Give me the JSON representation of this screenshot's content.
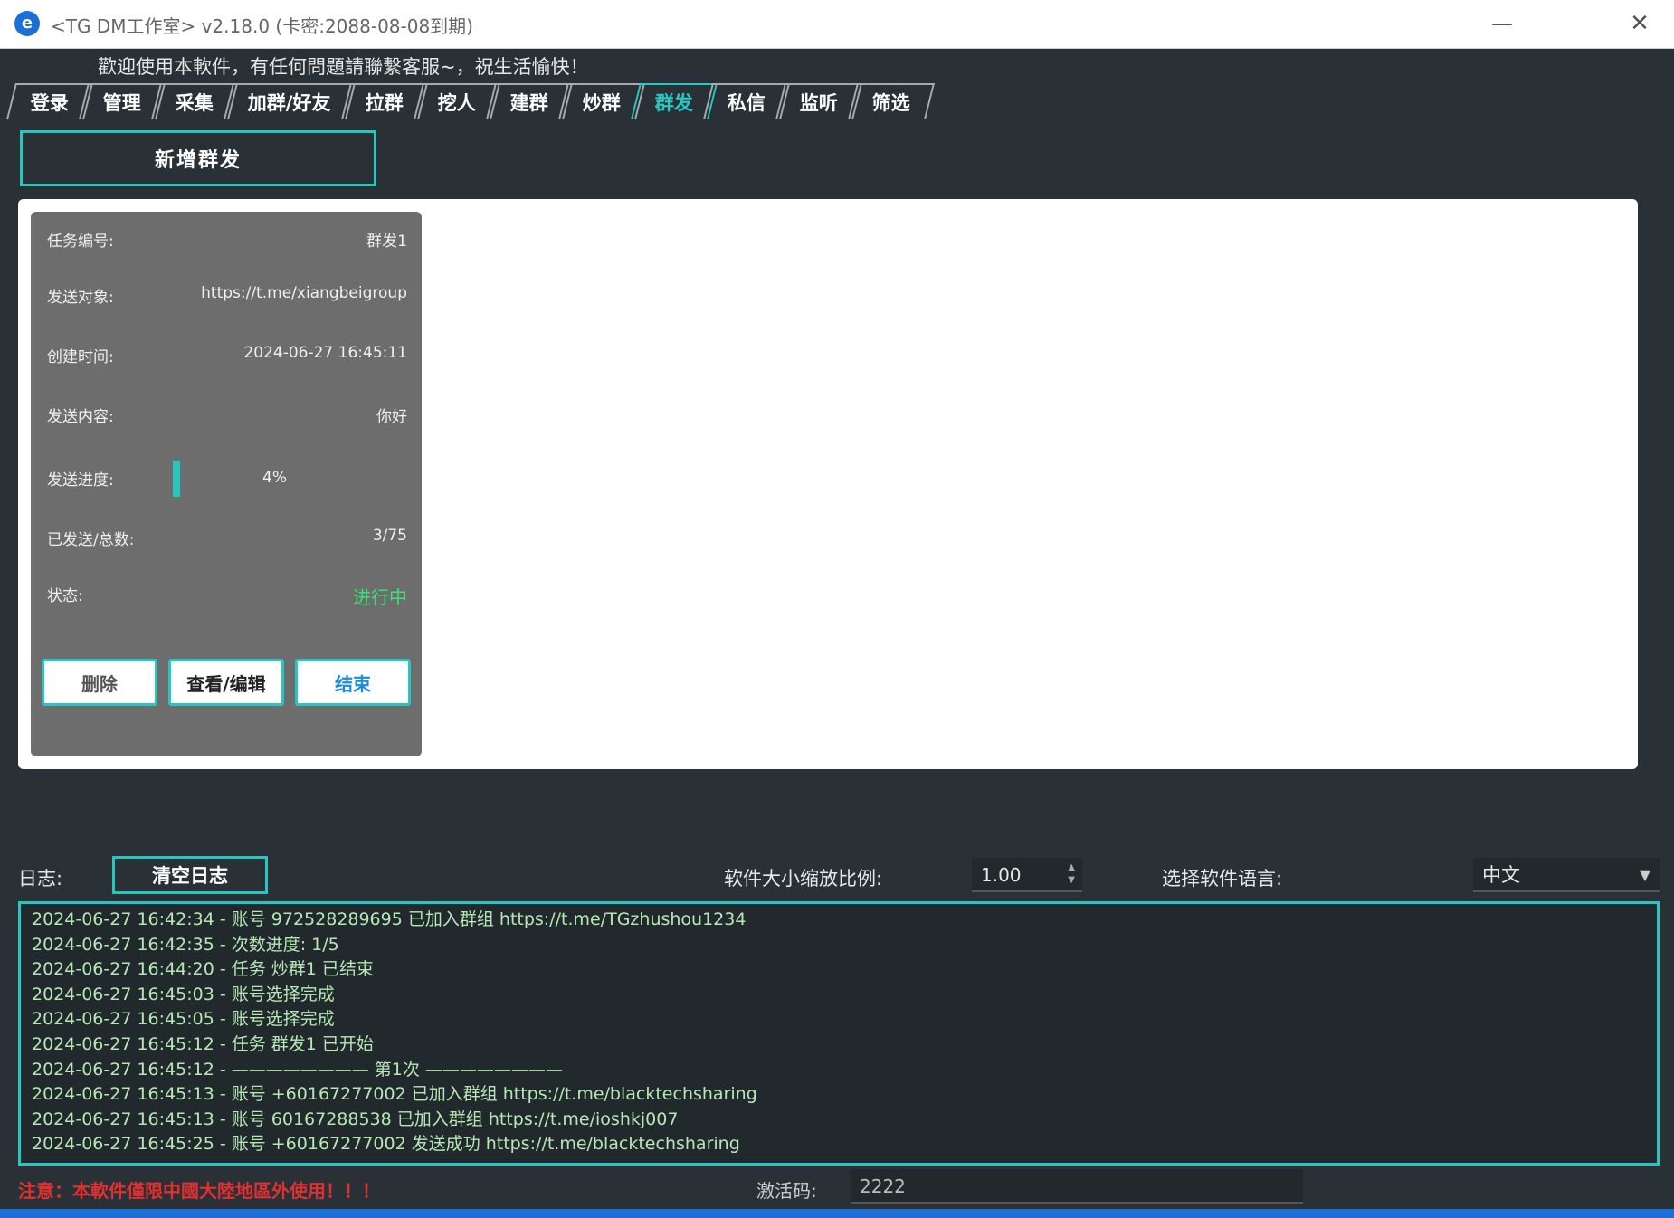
{
  "window": {
    "title": "<TG DM工作室> v2.18.0 (卡密:2088-08-08到期)",
    "minimize": "—",
    "close": "✕"
  },
  "welcome": "歡迎使用本軟件，有任何問題請聯繫客服~，祝生活愉快！",
  "tabs": [
    {
      "label": "登录",
      "active": false
    },
    {
      "label": "管理",
      "active": false
    },
    {
      "label": "采集",
      "active": false
    },
    {
      "label": "加群/好友",
      "active": false
    },
    {
      "label": "拉群",
      "active": false
    },
    {
      "label": "挖人",
      "active": false
    },
    {
      "label": "建群",
      "active": false
    },
    {
      "label": "炒群",
      "active": false
    },
    {
      "label": "群发",
      "active": true
    },
    {
      "label": "私信",
      "active": false
    },
    {
      "label": "监听",
      "active": false
    },
    {
      "label": "筛选",
      "active": false
    }
  ],
  "add_button": "新增群发",
  "task": {
    "id_label": "任务编号:",
    "id_value": "群发1",
    "target_label": "发送对象:",
    "target_value": "https://t.me/xiangbeigroup",
    "created_label": "创建时间:",
    "created_value": "2024-06-27 16:45:11",
    "content_label": "发送内容:",
    "content_value": "你好",
    "progress_label": "发送进度:",
    "progress_percent": 4,
    "progress_text": "4%",
    "sent_label": "已发送/总数:",
    "sent_value": "3/75",
    "status_label": "状态:",
    "status_value": "进行中",
    "delete_button": "删除",
    "view_button": "查看/编辑",
    "end_button": "结束"
  },
  "log": {
    "label": "日志:",
    "clear_button": "清空日志",
    "lines": [
      "2024-06-27 16:42:34 - 账号 972528289695 已加入群组 https://t.me/TGzhushou1234",
      "2024-06-27 16:42:35 - 次数进度: 1/5",
      "2024-06-27 16:44:20 - 任务 炒群1 已结束",
      "2024-06-27 16:45:03 - 账号选择完成",
      "2024-06-27 16:45:05 - 账号选择完成",
      "2024-06-27 16:45:12 - 任务 群发1 已开始",
      "2024-06-27 16:45:12 - ———————— 第1次 ————————",
      "2024-06-27 16:45:13 - 账号 +60167277002 已加入群组 https://t.me/blacktechsharing",
      "2024-06-27 16:45:13 - 账号 60167288538 已加入群组 https://t.me/ioshkj007",
      "2024-06-27 16:45:25 - 账号 +60167277002 发送成功 https://t.me/blacktechsharing"
    ]
  },
  "scale": {
    "label": "软件大小缩放比例:",
    "value": "1.00"
  },
  "language": {
    "label": "选择软件语言:",
    "value": "中文"
  },
  "footer": {
    "warning": "注意：本軟件僅限中國大陸地區外使用！！！",
    "activation_label": "激活码:",
    "activation_value": "2222"
  },
  "colors": {
    "accent": "#28c6c0",
    "background": "#2a3136",
    "status_ok": "#3ee07a",
    "warning": "#e03030"
  }
}
